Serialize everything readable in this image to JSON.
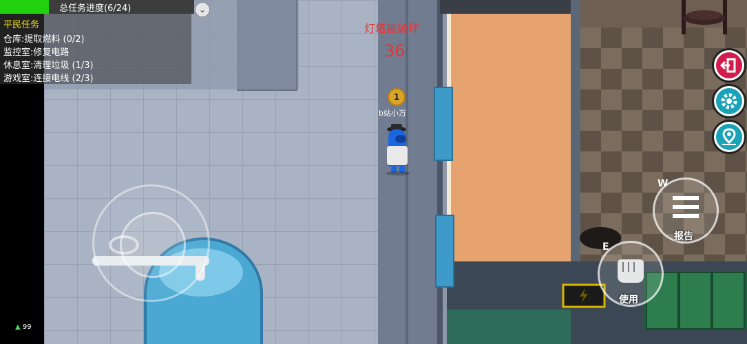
{
  "tasks": {
    "header": "总任务进度(6/24)",
    "progress": 0.25,
    "title": "平民任务",
    "items": [
      "仓库:提取燃料 (0/2)",
      "监控室:修复电路",
      "休息室:清理垃圾 (1/3)",
      "游戏室:连接电线 (2/3)"
    ]
  },
  "alert": {
    "message": "灯塔被破坏",
    "countdown": "36"
  },
  "player": {
    "badge": "1",
    "name": "b站小万",
    "color": "#1b67e0"
  },
  "controls": {
    "report": {
      "key": "W",
      "label": "报告"
    },
    "use": {
      "key": "E",
      "label": "使用"
    }
  },
  "side_buttons": [
    "exit-icon",
    "gear-icon",
    "map-pin-icon"
  ],
  "status": {
    "signal": "99"
  },
  "colors": {
    "progress": "#22d10e",
    "task_title": "#f5e21a",
    "alert": "#e23636",
    "side_button": "#18a3b9",
    "exit_button": "#d11c4d"
  }
}
